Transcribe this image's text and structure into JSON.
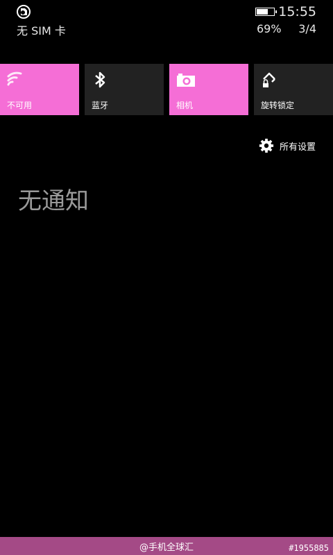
{
  "colors": {
    "accent": "#f56ed6",
    "dark_tile": "#222222",
    "background": "#000000",
    "muted_text": "#9a9a9a",
    "footer": "#a44a86"
  },
  "status": {
    "sim_label": "无 SIM 卡",
    "time": "15:55",
    "battery_percent_label": "69%",
    "battery_level": 0.69,
    "page_indicator": "3/4"
  },
  "quick_actions": [
    {
      "label": "不可用",
      "icon": "wifi-icon",
      "active": true
    },
    {
      "label": "蓝牙",
      "icon": "bluetooth-icon",
      "active": false
    },
    {
      "label": "相机",
      "icon": "camera-icon",
      "active": true
    },
    {
      "label": "旋转锁定",
      "icon": "rotation-lock-icon",
      "active": false
    }
  ],
  "settings": {
    "label": "所有设置",
    "icon": "gear-icon"
  },
  "notifications": {
    "empty_label": "无通知"
  },
  "footer": {
    "credit": "@手机全球汇",
    "id": "#1955885"
  }
}
